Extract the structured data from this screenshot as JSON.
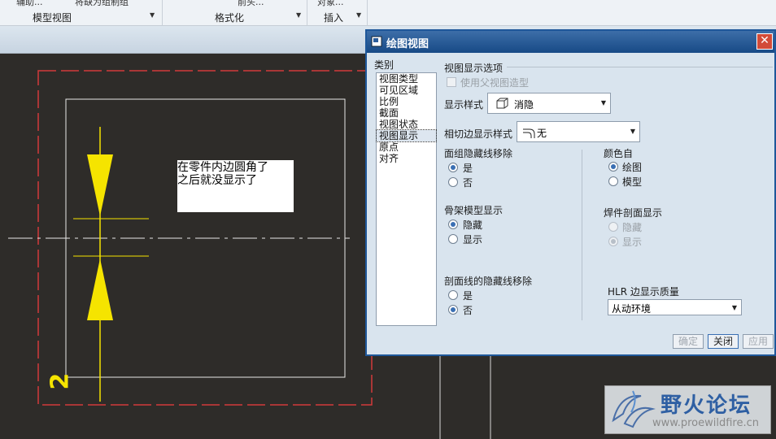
{
  "ribbon": {
    "top_items": [
      "辅助...",
      "将缺为组制组",
      "前头...",
      "对象..."
    ],
    "groups": [
      "模型视图",
      "格式化",
      "插入"
    ]
  },
  "canvas": {
    "annotation_line1": "在零件内边圆角了",
    "annotation_line2": "之后就没显示了",
    "dimension_text": "2"
  },
  "dialog": {
    "title": "绘图视图",
    "close_label": "✕",
    "category_label": "类别",
    "categories": [
      "视图类型",
      "可见区域",
      "比例",
      "截面",
      "视图状态",
      "视图显示",
      "原点",
      "对齐"
    ],
    "selected_category": "视图显示",
    "section_title": "视图显示选项",
    "use_parent_label": "使用父视图造型",
    "display_style_label": "显示样式",
    "display_style_value": "消隐",
    "tangent_label": "相切边显示样式",
    "tangent_value": "无",
    "face_group_label": "面组隐藏线移除",
    "face_group_options": [
      "是",
      "否"
    ],
    "face_group_selected": "是",
    "skeleton_label": "骨架模型显示",
    "skeleton_options": [
      "隐藏",
      "显示"
    ],
    "skeleton_selected": "隐藏",
    "section_hidden_label": "剖面线的隐藏线移除",
    "section_hidden_options": [
      "是",
      "否"
    ],
    "section_hidden_selected": "否",
    "color_label": "颜色自",
    "color_options": [
      "绘图",
      "模型"
    ],
    "color_selected": "绘图",
    "weld_label": "焊件剖面显示",
    "weld_options": [
      "隐藏",
      "显示"
    ],
    "weld_selected": "显示",
    "hlr_label": "HLR 边显示质量",
    "hlr_value": "从动环境",
    "buttons": {
      "ok": "确定",
      "close": "关闭",
      "apply": "应用"
    }
  },
  "watermark": {
    "title": "野火论坛",
    "url": "www.proewildfire.cn"
  },
  "colors": {
    "canvas_bg": "#2e2c29",
    "drawing_border": "#d23a3a",
    "dimension": "#f5e400",
    "dialog_bg": "#d9e4ee",
    "titlebar": "#174a86"
  }
}
